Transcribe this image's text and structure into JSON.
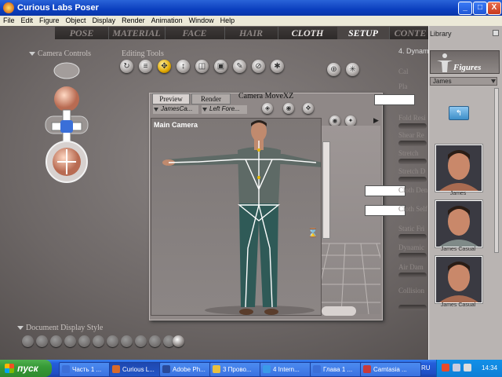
{
  "window": {
    "title": "Curious Labs Poser",
    "minimize": "_",
    "maximize": "□",
    "close": "X"
  },
  "menu": [
    "File",
    "Edit",
    "Figure",
    "Object",
    "Display",
    "Render",
    "Animation",
    "Window",
    "Help"
  ],
  "rooms": [
    "POSE",
    "MATERIAL",
    "FACE",
    "HAIR",
    "CLOTH",
    "SETUP",
    "CONTE"
  ],
  "active_room": "SETUP",
  "camera_controls_label": "Camera Controls",
  "editing_tools_label": "Editing Tools",
  "document": {
    "tab_preview": "Preview",
    "tab_render": "Render",
    "camera_move_label": "Camera MoveXZ",
    "figure_select": "JamesCa...",
    "part_select": "Left Fore...",
    "camera_name": "Main Camera"
  },
  "side_params": {
    "header": "4. Dynam",
    "items": [
      "Cal",
      "Pla",
      "Fold Resi",
      "Shear Re",
      "Stretch",
      "Stretch D",
      "Cloth Den",
      "Cloth Self",
      "Static Fri",
      "Dynamic",
      "Air Dam",
      "Collision"
    ]
  },
  "library": {
    "title": "Library",
    "category": "Figures",
    "folder": "James",
    "items": [
      "James",
      "James Casual",
      "James Casual"
    ]
  },
  "document_display_style_label": "Document Display Style",
  "taskbar": {
    "start": "пуск",
    "tasks": [
      "Часть 1 ...",
      "Curious L...",
      "Adobe Ph...",
      "3 Прово...",
      "4 Intern...",
      "Глава 1 ...",
      "Camtasia ..."
    ],
    "active_task": "Curious L...",
    "language": "RU",
    "clock": "14:34"
  },
  "colors": {
    "titlebar": "#0b3fbf",
    "workspace": "#6d6766",
    "active_tool": "#e0a800",
    "library_bg": "#b9b4b2",
    "figure_shirt": "#5e6a66",
    "figure_pants": "#2f5a57"
  }
}
